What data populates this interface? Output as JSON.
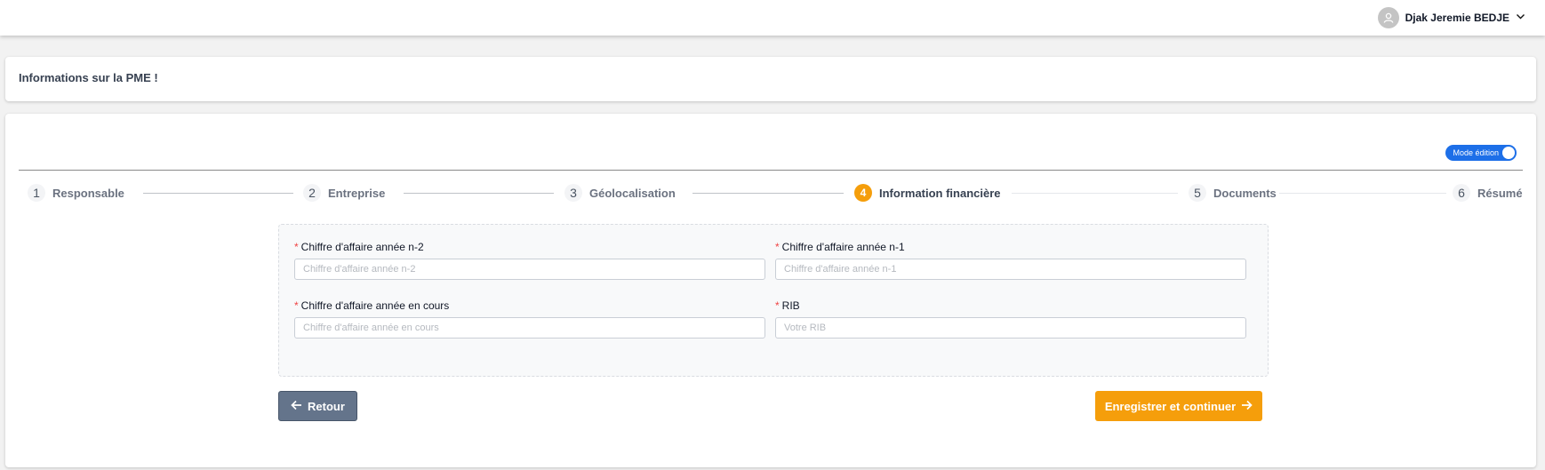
{
  "user": {
    "name": "Djak Jeremie BEDJE"
  },
  "page": {
    "title": "Informations sur la PME !"
  },
  "edit_toggle": {
    "label": "Mode édition",
    "on": true
  },
  "steps": [
    {
      "num": "1",
      "label": "Responsable"
    },
    {
      "num": "2",
      "label": "Entreprise"
    },
    {
      "num": "3",
      "label": "Géolocalisation"
    },
    {
      "num": "4",
      "label": "Information financière",
      "active": true
    },
    {
      "num": "5",
      "label": "Documents"
    },
    {
      "num": "6",
      "label": "Résumé"
    }
  ],
  "form": {
    "required_mark": "*",
    "fields": [
      {
        "label": "Chiffre d'affaire année n-2",
        "placeholder": "Chiffre d'affaire année n-2",
        "value": ""
      },
      {
        "label": "Chiffre d'affaire année n-1",
        "placeholder": "Chiffre d'affaire année n-1",
        "value": ""
      },
      {
        "label": "Chiffre d'affaire année en cours",
        "placeholder": "Chiffre d'affaire année en cours",
        "value": ""
      },
      {
        "label": "RIB",
        "placeholder": "Votre RIB",
        "value": ""
      }
    ]
  },
  "buttons": {
    "back": "Retour",
    "next": "Enregistrer et continuer"
  },
  "colors": {
    "accent": "#f59e0b",
    "toggle": "#1d6fe8",
    "back_button": "#64748b"
  }
}
